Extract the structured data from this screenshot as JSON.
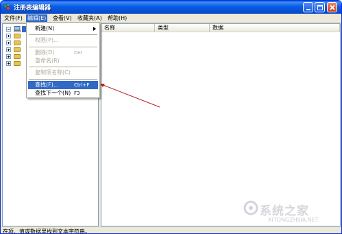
{
  "window": {
    "title": "注册表编辑器",
    "controls": {
      "minimize": "minimize",
      "maximize": "maximize",
      "close": "close"
    }
  },
  "menubar": {
    "items": [
      "文件(F)",
      "编辑(E)",
      "查看(V)",
      "收藏夹(A)",
      "帮助(H)"
    ],
    "active_index": 1
  },
  "list": {
    "columns": [
      "名称",
      "类型",
      "数据"
    ]
  },
  "edit_menu": {
    "items": [
      {
        "label": "新建(N)",
        "shortcut": "",
        "submenu": true,
        "disabled": false
      },
      {
        "label": "权限(P)...",
        "shortcut": "",
        "disabled": true
      },
      {
        "label": "删除(D)",
        "shortcut": "Del",
        "disabled": true
      },
      {
        "label": "重命名(R)",
        "shortcut": "",
        "disabled": true
      },
      {
        "label": "复制项名称(C)",
        "shortcut": "",
        "disabled": true
      },
      {
        "label": "查找(F)...",
        "shortcut": "Ctrl+F",
        "disabled": false,
        "highlighted": true
      },
      {
        "label": "查找下一个(N)",
        "shortcut": "F3",
        "disabled": false
      }
    ]
  },
  "tree": {
    "root_expanded": true,
    "child_folders": 5
  },
  "status": {
    "text": "在项、值或数据里找到文本字符串。"
  },
  "watermark": {
    "text": "系统之家",
    "url": "XITONGZHIJIA.NET"
  },
  "colors": {
    "title_blue": "#0b5ce5",
    "menu_highlight": "#316ac5",
    "annotation_arrow": "#b22222",
    "chrome": "#ece9d8"
  }
}
